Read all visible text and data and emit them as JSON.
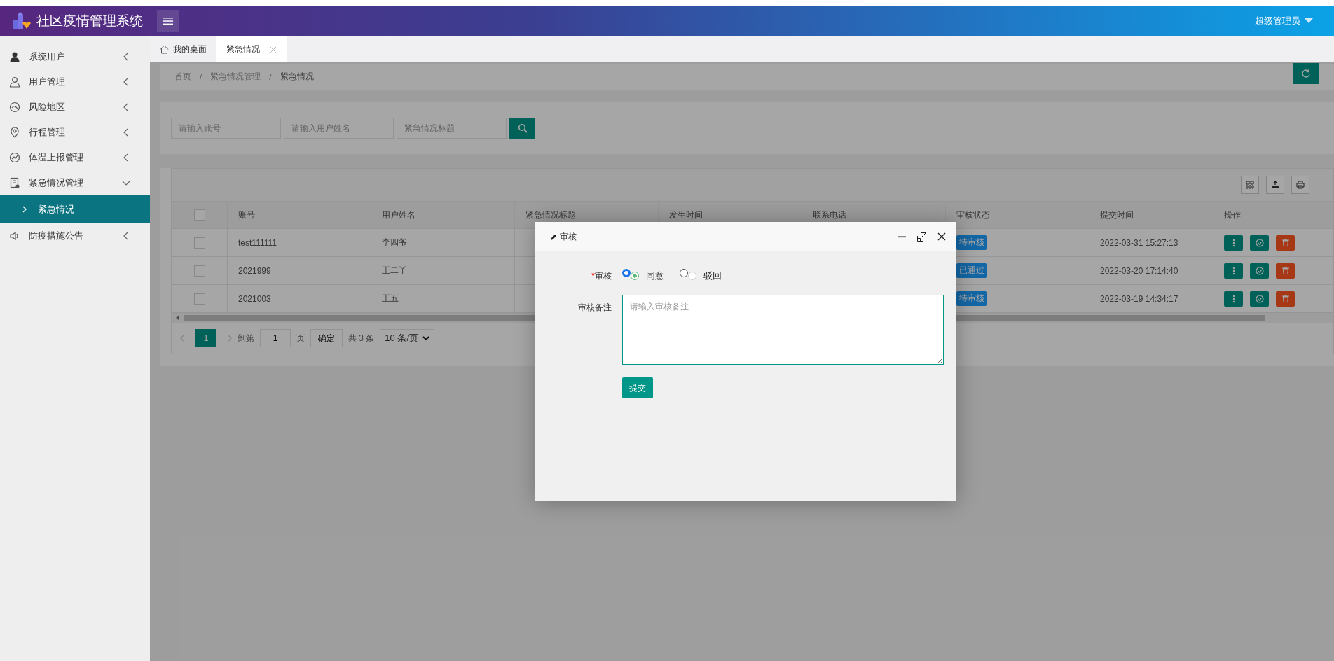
{
  "header": {
    "title": "社区疫情管理系统",
    "user": "超级管理员"
  },
  "sidebar": {
    "items": [
      {
        "label": "系统用户",
        "expanded": false
      },
      {
        "label": "用户管理",
        "expanded": false
      },
      {
        "label": "风险地区",
        "expanded": false
      },
      {
        "label": "行程管理",
        "expanded": false
      },
      {
        "label": "体温上报管理",
        "expanded": false
      },
      {
        "label": "紧急情况管理",
        "expanded": true,
        "children": [
          {
            "label": "紧急情况",
            "selected": true
          }
        ]
      },
      {
        "label": "防疫措施公告",
        "expanded": false
      }
    ]
  },
  "tabs": [
    {
      "label": "我的桌面",
      "selected": false
    },
    {
      "label": "紧急情况",
      "selected": true
    }
  ],
  "breadcrumb": {
    "separator": "/",
    "items": [
      "首页",
      "紧急情况管理",
      "紧急情况"
    ]
  },
  "search": {
    "fields": [
      {
        "placeholder": "请输入账号"
      },
      {
        "placeholder": "请输入用户姓名"
      },
      {
        "placeholder": "紧急情况标题"
      }
    ]
  },
  "table": {
    "all_checked": false,
    "columns": [
      "账号",
      "用户姓名",
      "紧急情况标题",
      "发生时间",
      "联系电话",
      "审核状态",
      "提交时间",
      "操作"
    ],
    "rows": [
      {
        "checked": false,
        "account": "test111111",
        "name": "李四爷",
        "status": "待审核",
        "submitted": "2022-03-31 15:27:13"
      },
      {
        "checked": false,
        "account": "2021999",
        "name": "王二丫",
        "status": "已通过",
        "submitted": "2022-03-20 17:14:40"
      },
      {
        "checked": false,
        "account": "2021003",
        "name": "王五",
        "status": "待审核",
        "submitted": "2022-03-19 14:34:17"
      }
    ]
  },
  "pagination": {
    "pages": [
      {
        "label": "1",
        "selected": true
      }
    ],
    "goto_label": "到第",
    "goto_value": "1",
    "page_unit": "页",
    "confirm": "确定",
    "total": "共 3 条",
    "page_size": "10 条/页"
  },
  "dialog": {
    "title": "审核",
    "field_label": "审核",
    "required_mark": "*",
    "options": [
      {
        "label": "同意",
        "selected": true
      },
      {
        "label": "驳回",
        "selected": false
      }
    ],
    "remark_label": "审核备注",
    "remark_placeholder": "请输入审核备注",
    "submit": "提交"
  }
}
